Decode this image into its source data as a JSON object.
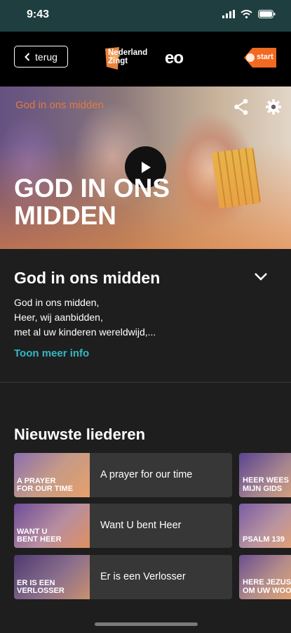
{
  "status_bar": {
    "time": "9:43"
  },
  "nav": {
    "back_label": "terug",
    "logo_nz_line1": "Nederland",
    "logo_nz_line2": "Zingt",
    "logo_eo": "eo",
    "logo_npo": "start"
  },
  "hero": {
    "subtitle": "God in ons midden",
    "title": "GOD IN ONS MIDDEN",
    "accent": "#e27a3f"
  },
  "song_info": {
    "title": "God in ons midden",
    "lyrics_line1": "God in ons midden,",
    "lyrics_line2": "Heer, wij aanbidden,",
    "lyrics_line3": "met al uw kinderen wereldwijd,...",
    "more_link": "Toon meer info",
    "link_color": "#32b8c4"
  },
  "newest": {
    "heading": "Nieuwste liederen",
    "songs": [
      {
        "title": "A prayer for our time",
        "thumb_caption_1": "A PRAYER",
        "thumb_caption_2": "FOR OUR TIME"
      },
      {
        "title": "Want U bent Heer",
        "thumb_caption_1": "WANT U",
        "thumb_caption_2": "BENT HEER"
      },
      {
        "title": "Er is een Verlosser",
        "thumb_caption_1": "ER IS EEN",
        "thumb_caption_2": "VERLOSSER"
      }
    ],
    "side_thumbs": [
      {
        "caption_1": "HEER WEES",
        "caption_2": "MIJN GIDS"
      },
      {
        "caption_1": "PSALM 139",
        "caption_2": ""
      },
      {
        "caption_1": "HERE JEZUS",
        "caption_2": "OM UW WOO"
      }
    ]
  }
}
